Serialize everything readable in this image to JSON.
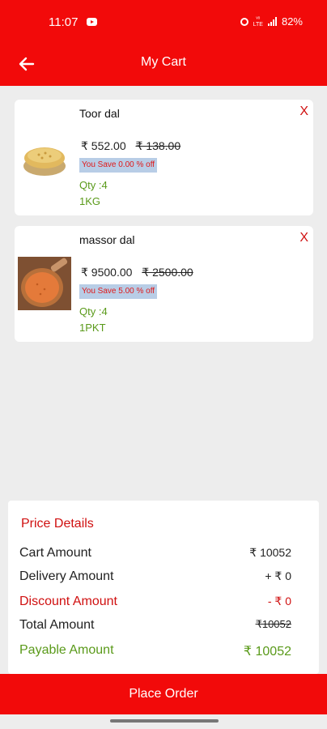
{
  "status_bar": {
    "time": "11:07",
    "network_top": "ᵛᵒ",
    "network_bottom": "LTE",
    "signal_label": "Vo LTE",
    "battery": "82%"
  },
  "app_bar": {
    "title": "My Cart",
    "back_icon": "arrow-left-icon"
  },
  "cart_items": [
    {
      "name": "Toor dal",
      "price": "₹ 552.00",
      "old_price": "₹ 138.00",
      "save_text": "You Save 0.00 % off",
      "qty": "Qty :4",
      "unit": "1KG",
      "remove_label": "X"
    },
    {
      "name": "massor dal",
      "price": "₹ 9500.00",
      "old_price": "₹ 2500.00",
      "save_text": "You Save 5.00 % off",
      "qty": "Qty :4",
      "unit": "1PKT",
      "remove_label": "X"
    }
  ],
  "price_details": {
    "title": "Price Details",
    "rows": [
      {
        "label": "Cart Amount",
        "value": "₹ 10052"
      },
      {
        "label": "Delivery Amount",
        "value": "+ ₹ 0"
      },
      {
        "label": "Discount Amount",
        "value": "- ₹ 0"
      },
      {
        "label": "Total Amount",
        "value": "₹10052"
      },
      {
        "label": "Payable Amount",
        "value": "₹ 10052"
      }
    ]
  },
  "place_order_label": "Place Order",
  "colors": {
    "primary_red": "#f20a0a",
    "discount_red": "#d01010",
    "payable_green": "#5a9a1a",
    "save_tag_bg": "#b8cde6"
  }
}
